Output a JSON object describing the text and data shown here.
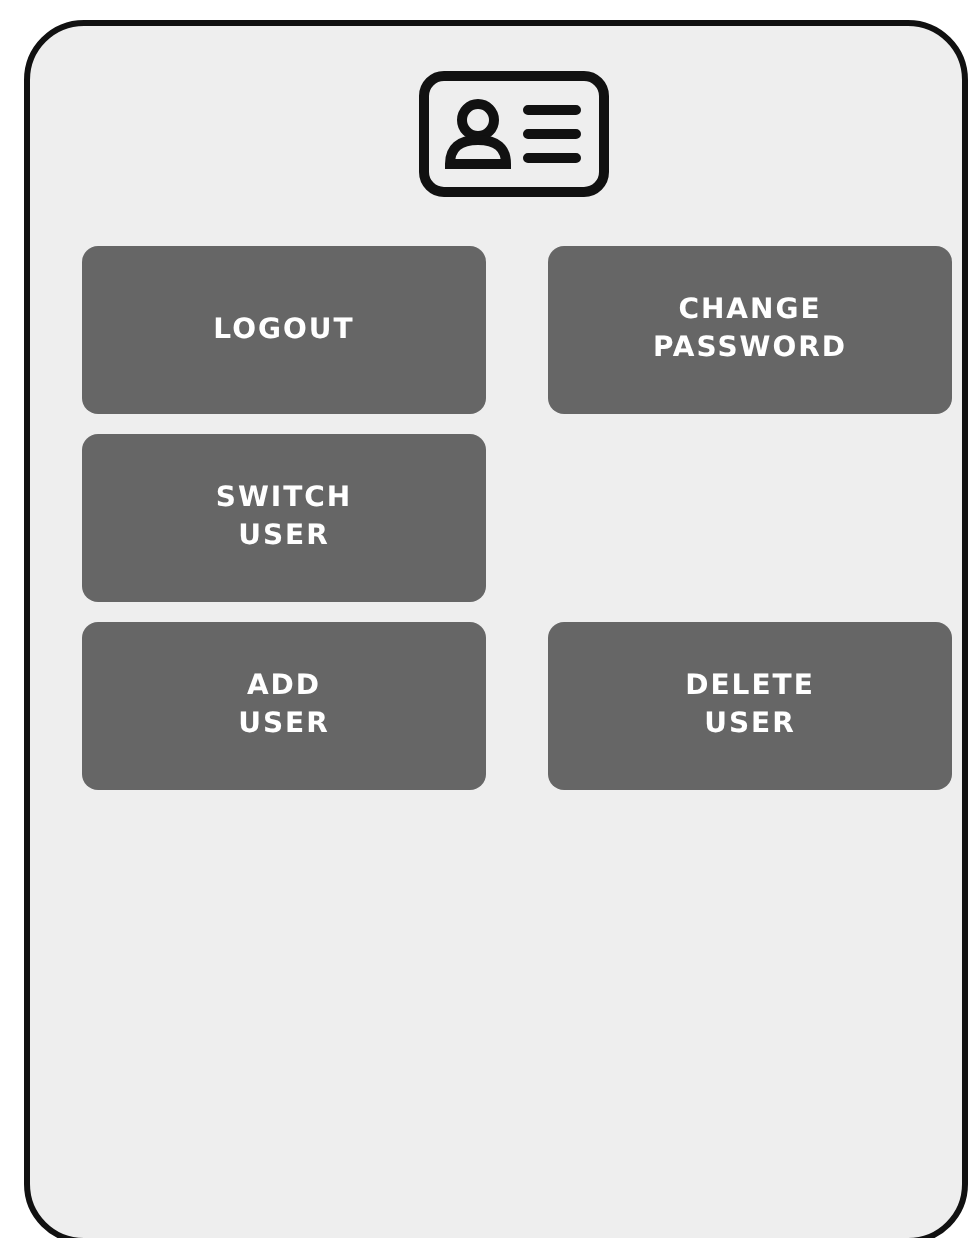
{
  "button_rows": [
    {
      "buttons": [
        "LOGOUT",
        "CHANGE\nPASSWORD"
      ]
    },
    {
      "buttons": [
        "SWITCH\nUSER"
      ]
    },
    {
      "buttons": [
        "ADD\nUSER",
        "DELETE\nUSER"
      ]
    }
  ]
}
